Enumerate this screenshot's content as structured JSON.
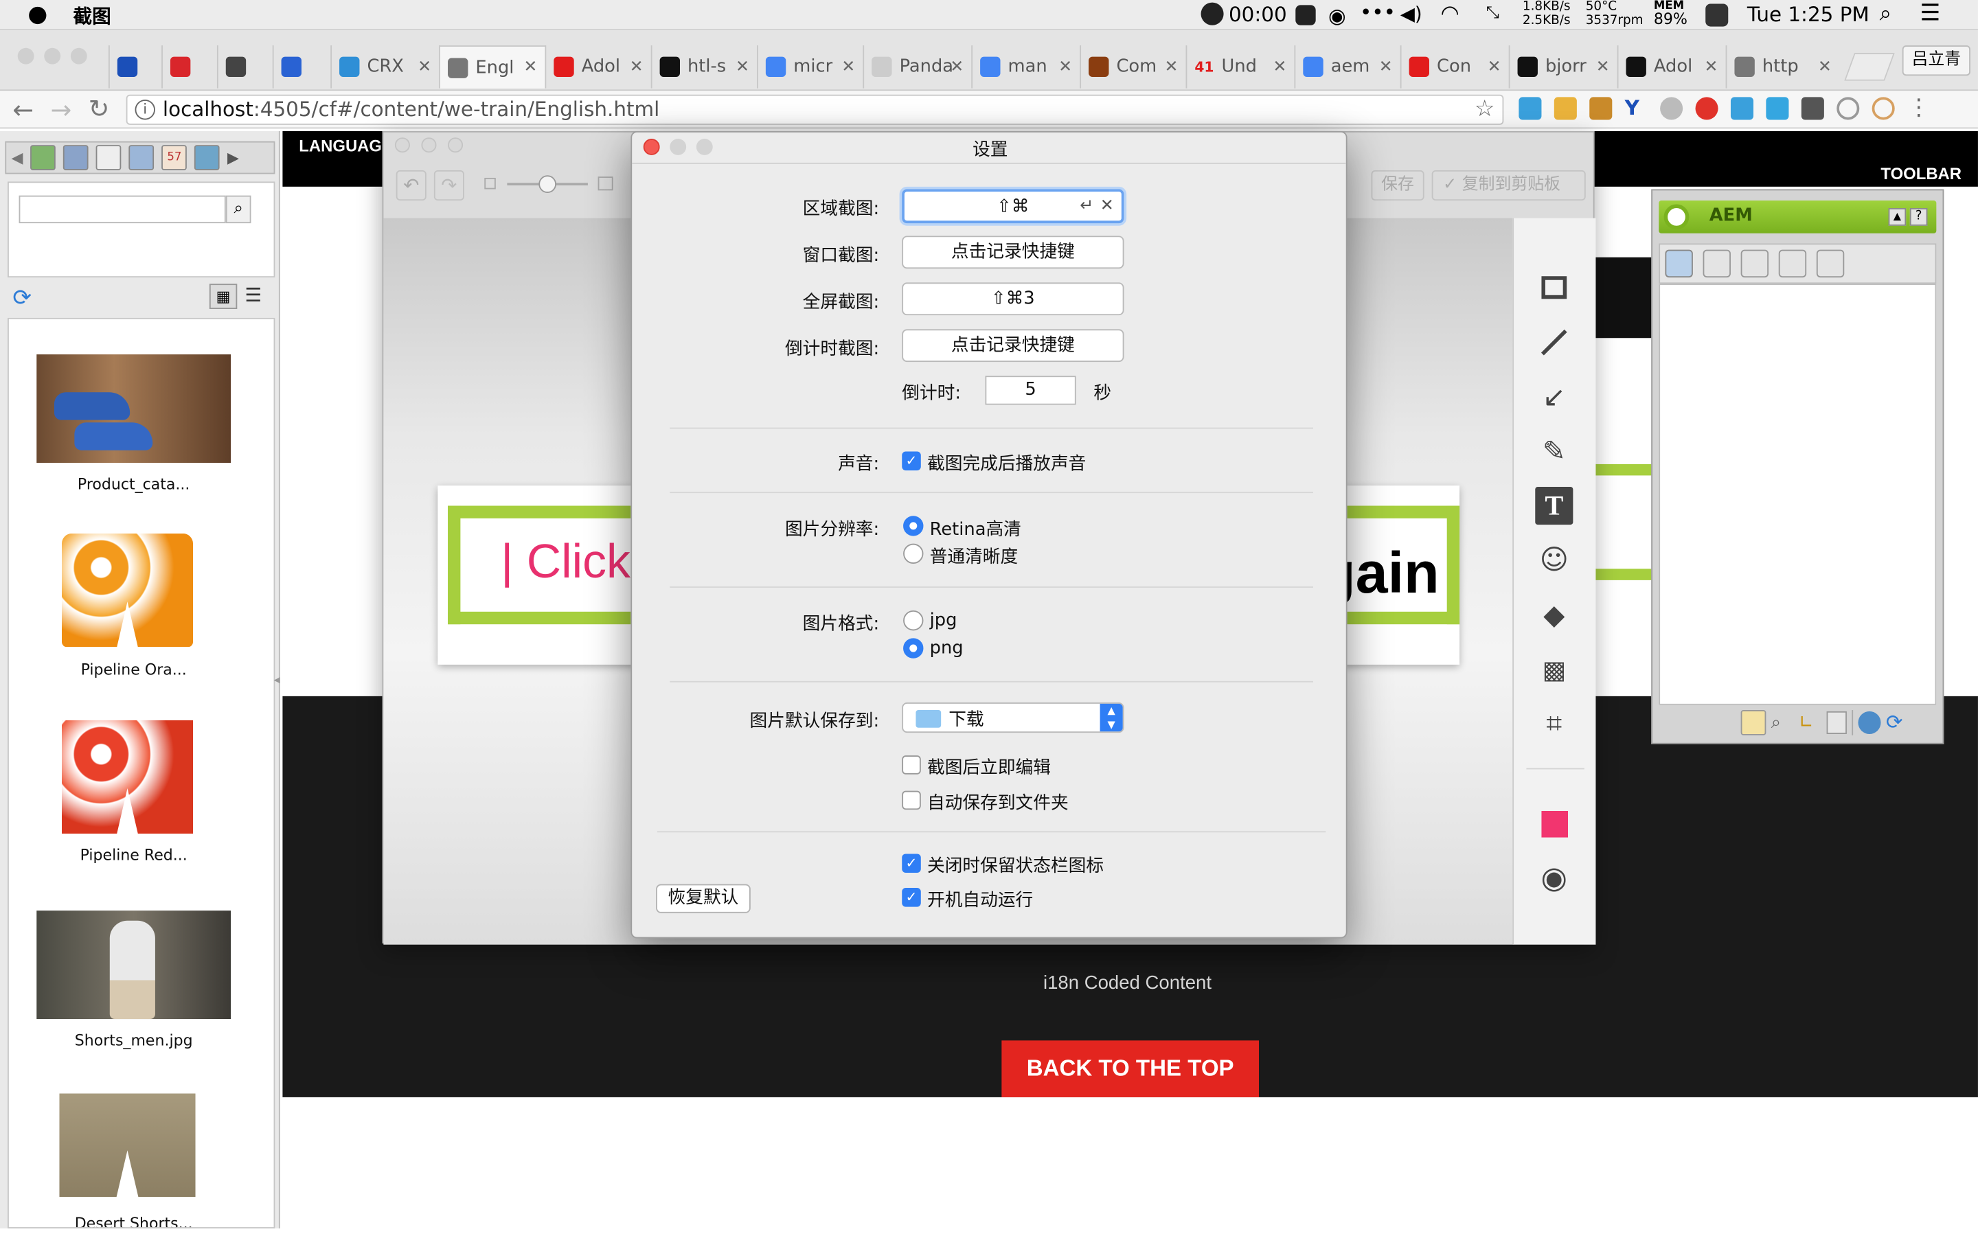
{
  "menubar": {
    "app_name": "截图",
    "timer": "00:00",
    "net_up": "1.8KB/s",
    "net_down": "2.5KB/s",
    "cpu_temp": "50°C",
    "fan": "3537rpm",
    "mem_label": "MEM",
    "mem_value": "89%",
    "clock": "Tue 1:25 PM"
  },
  "browser": {
    "tabs": [
      {
        "label": "",
        "color": "#1b4fb8"
      },
      {
        "label": "",
        "color": "#d9262b"
      },
      {
        "label": "",
        "color": "#444444"
      },
      {
        "label": "",
        "color": "#2962d3"
      },
      {
        "label": "CRX",
        "color": "#2f8fd6"
      },
      {
        "label": "Engl",
        "color": "#777777"
      },
      {
        "label": "Adol",
        "color": "#e21c1c"
      },
      {
        "label": "htl-s",
        "color": "#111111"
      },
      {
        "label": "micr",
        "color": "#4285f4"
      },
      {
        "label": "Panda",
        "color": "#cccccc"
      },
      {
        "label": "man",
        "color": "#4285f4"
      },
      {
        "label": "Com",
        "color": "#8a3d10"
      },
      {
        "label": "Und",
        "color": "#e11d1d"
      },
      {
        "label": "aem",
        "color": "#4285f4"
      },
      {
        "label": "Con",
        "color": "#e21c1c"
      },
      {
        "label": "bjorr",
        "color": "#111111"
      },
      {
        "label": "Adol",
        "color": "#111111"
      },
      {
        "label": "http",
        "color": "#777777"
      }
    ],
    "tab41_badge": "41",
    "profile_name": "吕立青",
    "url_host": "localhost",
    "url_rest": ":4505/cf#/content/we-train/English.html"
  },
  "aem_panel": {
    "search_placeholder": "",
    "assets": [
      {
        "caption": "Product_cata..."
      },
      {
        "caption": "Pipeline Ora..."
      },
      {
        "caption": "Pipeline Red..."
      },
      {
        "caption": "Shorts_men.jpg"
      },
      {
        "caption": "Desert Shorts..."
      }
    ]
  },
  "page": {
    "language_label": "LANGUAG",
    "toolbar_label": "TOOLBAR",
    "click_text": "| Click",
    "again_text": "gain",
    "i18n_text": "i18n Coded Content",
    "back_to_top": "BACK TO THE TOP"
  },
  "editor": {
    "save_label": "保存",
    "copy_label": "复制到剪贴板",
    "tools": [
      "rectangle-tool-icon",
      "line-tool-icon",
      "arrow-tool-icon",
      "pencil-tool-icon",
      "text-tool-icon",
      "emoji-tool-icon",
      "tag-tool-icon",
      "mosaic-tool-icon",
      "crop-tool-icon"
    ],
    "current_color": "#f2356f"
  },
  "settings": {
    "title": "设置",
    "area_label": "区域截图:",
    "area_value": "⇧⌘",
    "window_label": "窗口截图:",
    "window_value": "点击记录快捷键",
    "fullscreen_label": "全屏截图:",
    "fullscreen_value": "⇧⌘3",
    "countdown_shot_label": "倒计时截图:",
    "countdown_shot_value": "点击记录快捷键",
    "countdown_label": "倒计时:",
    "countdown_value": "5",
    "countdown_unit": "秒",
    "sound_label": "声音:",
    "sound_option": "截图完成后播放声音",
    "resolution_label": "图片分辨率:",
    "resolution_retina": "Retina高清",
    "resolution_normal": "普通清晰度",
    "format_label": "图片格式:",
    "format_jpg": "jpg",
    "format_png": "png",
    "save_to_label": "图片默认保存到:",
    "save_to_value": "下载",
    "edit_after": "截图后立即编辑",
    "auto_save": "自动保存到文件夹",
    "keep_status_icon": "关闭时保留状态栏图标",
    "launch_at_login": "开机自动运行",
    "restore_defaults": "恢复默认"
  },
  "sidekick": {
    "title": "AEM"
  }
}
